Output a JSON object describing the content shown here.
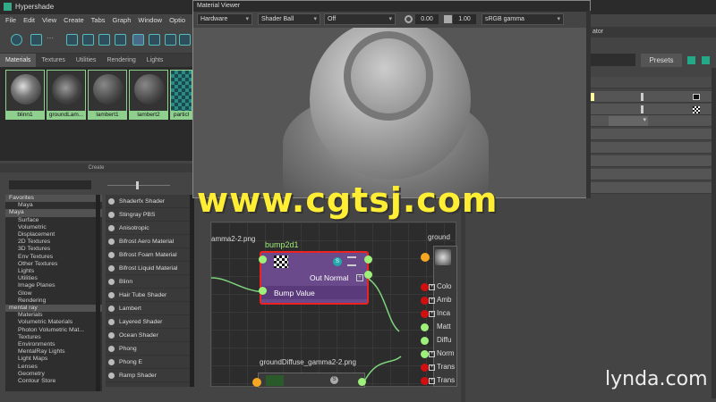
{
  "window": {
    "title": "Hypershade"
  },
  "menu": [
    "File",
    "Edit",
    "View",
    "Create",
    "Tabs",
    "Graph",
    "Window",
    "Optio"
  ],
  "tabs": [
    {
      "label": "Materials",
      "active": true
    },
    {
      "label": "Textures",
      "active": false
    },
    {
      "label": "Utilities",
      "active": false
    },
    {
      "label": "Rendering",
      "active": false
    },
    {
      "label": "Lights",
      "active": false
    }
  ],
  "swatches": [
    "blinn1",
    "groundLam...",
    "lambert1",
    "lambert2",
    "particl"
  ],
  "create": {
    "title": "Create"
  },
  "tree": [
    {
      "label": "Favorites",
      "header": true
    },
    {
      "label": "Maya",
      "header": false
    },
    {
      "label": "Maya",
      "header": true
    },
    {
      "label": "Surface",
      "header": false
    },
    {
      "label": "Volumetric",
      "header": false
    },
    {
      "label": "Displacement",
      "header": false
    },
    {
      "label": "2D Textures",
      "header": false
    },
    {
      "label": "3D Textures",
      "header": false
    },
    {
      "label": "Env Textures",
      "header": false
    },
    {
      "label": "Other Textures",
      "header": false
    },
    {
      "label": "Lights",
      "header": false
    },
    {
      "label": "Utilities",
      "header": false
    },
    {
      "label": "Image Planes",
      "header": false
    },
    {
      "label": "Glow",
      "header": false
    },
    {
      "label": "Rendering",
      "header": false
    },
    {
      "label": "mental ray",
      "header": true
    },
    {
      "label": "Materials",
      "header": false
    },
    {
      "label": "Volumetric Materials",
      "header": false
    },
    {
      "label": "Photon Volumetric Mat...",
      "header": false
    },
    {
      "label": "Textures",
      "header": false
    },
    {
      "label": "Environments",
      "header": false
    },
    {
      "label": "MentalRay Lights",
      "header": false
    },
    {
      "label": "Light Maps",
      "header": false
    },
    {
      "label": "Lenses",
      "header": false
    },
    {
      "label": "Geometry",
      "header": false
    },
    {
      "label": "Contour Store",
      "header": false
    }
  ],
  "nodes": [
    "Shaderfx Shader",
    "Stingray PBS",
    "Anisotropic",
    "Bifrost Aero Material",
    "Bifrost Foam Material",
    "Bifrost Liquid Material",
    "Blinn",
    "Hair Tube Shader",
    "Lambert",
    "Layered Shader",
    "Ocean Shader",
    "Phong",
    "Phong E",
    "Ramp Shader"
  ],
  "viewer": {
    "title": "Material Viewer",
    "renderer": "Hardware",
    "geometry": "Shader Ball",
    "env": "Off",
    "exposure": "0.00",
    "gamma": "1.00",
    "colorspace": "sRGB gamma"
  },
  "graph": {
    "left_node": "amma2-2.png",
    "bump_title": "bump2d1",
    "bump_out": "Out Normal",
    "bump_in": "Bump Value",
    "ground_title": "ground",
    "ground_diffuse": "groundDiffuse_gamma2-2.png",
    "ports": [
      "Colo",
      "Amb",
      "Inca",
      "Matt",
      "Diffu",
      "Norm",
      "Trans",
      "Trans"
    ]
  },
  "attr_editor": {
    "partial_label": "ator",
    "presets": "Presets"
  },
  "watermark": "www.cgtsj.com",
  "brand": "lynda.com"
}
